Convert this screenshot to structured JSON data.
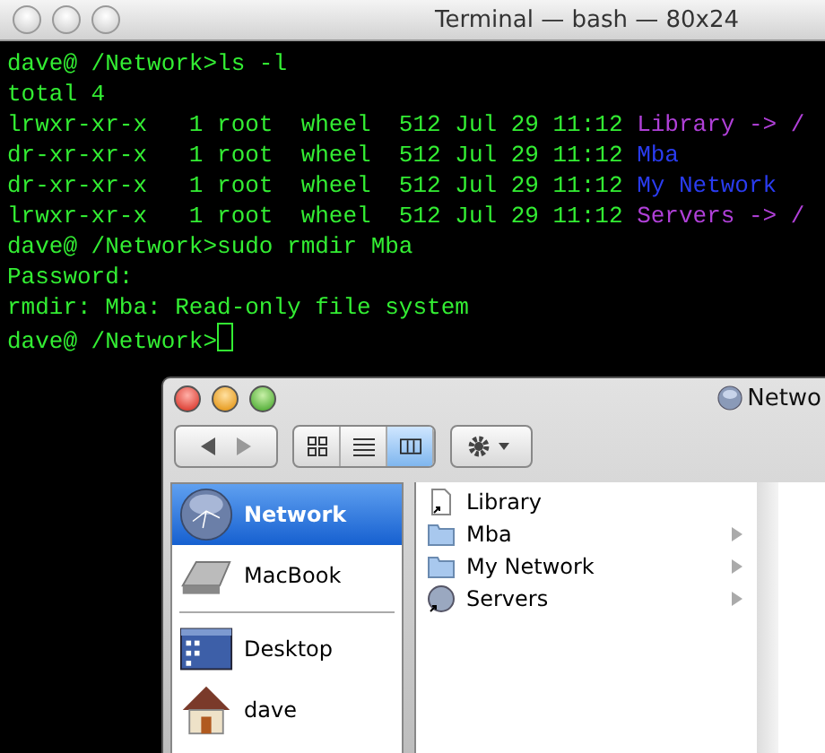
{
  "terminal": {
    "title": "Terminal — bash — 80x24",
    "lines": [
      {
        "segments": [
          {
            "text": "dave@ /Network>ls -l",
            "color": "#33ee33"
          }
        ]
      },
      {
        "segments": [
          {
            "text": "total 4",
            "color": "#33ee33"
          }
        ]
      },
      {
        "segments": [
          {
            "text": "lrwxr-xr-x   1 root  wheel  512 Jul 29 11:12 ",
            "color": "#33ee33"
          },
          {
            "text": "Library -> /",
            "color": "#b040d8"
          }
        ]
      },
      {
        "segments": [
          {
            "text": "dr-xr-xr-x   1 root  wheel  512 Jul 29 11:12 ",
            "color": "#33ee33"
          },
          {
            "text": "Mba",
            "color": "#2a3cf0"
          }
        ]
      },
      {
        "segments": [
          {
            "text": "dr-xr-xr-x   1 root  wheel  512 Jul 29 11:12 ",
            "color": "#33ee33"
          },
          {
            "text": "My Network",
            "color": "#2a3cf0"
          }
        ]
      },
      {
        "segments": [
          {
            "text": "lrwxr-xr-x   1 root  wheel  512 Jul 29 11:12 ",
            "color": "#33ee33"
          },
          {
            "text": "Servers -> /",
            "color": "#b040d8"
          }
        ]
      },
      {
        "segments": [
          {
            "text": "dave@ /Network>sudo rmdir Mba",
            "color": "#33ee33"
          }
        ]
      },
      {
        "segments": [
          {
            "text": "Password:",
            "color": "#33ee33"
          }
        ]
      },
      {
        "segments": [
          {
            "text": "rmdir: Mba: Read-only file system",
            "color": "#33ee33"
          }
        ]
      },
      {
        "segments": [
          {
            "text": "dave@ /Network>",
            "color": "#33ee33"
          }
        ],
        "cursor": true
      }
    ]
  },
  "finder": {
    "title": "Netwo",
    "views": [
      {
        "kind": "icon",
        "selected": false
      },
      {
        "kind": "list",
        "selected": false
      },
      {
        "kind": "column",
        "selected": true
      }
    ],
    "sidebar": [
      {
        "label": "Network",
        "kind": "network",
        "selected": true
      },
      {
        "label": "MacBook",
        "kind": "disk",
        "selected": false
      },
      {
        "label": "Desktop",
        "kind": "desktop",
        "selected": false
      },
      {
        "label": "dave",
        "kind": "home",
        "selected": false
      }
    ],
    "column": [
      {
        "label": "Library",
        "kind": "alias",
        "has_children": false
      },
      {
        "label": "Mba",
        "kind": "folder",
        "has_children": true
      },
      {
        "label": "My Network",
        "kind": "folder",
        "has_children": true
      },
      {
        "label": "Servers",
        "kind": "server",
        "has_children": true
      }
    ]
  }
}
